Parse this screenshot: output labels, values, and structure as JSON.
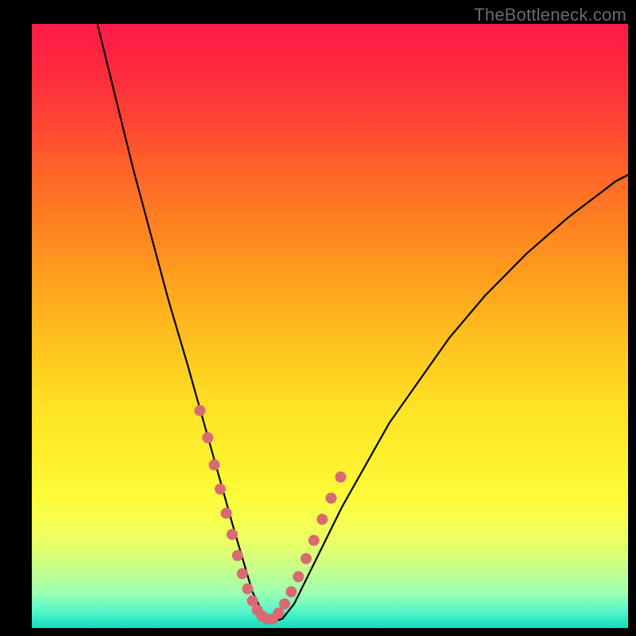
{
  "watermark": "TheBottleneck.com",
  "chart_data": {
    "type": "line",
    "title": "",
    "xlabel": "",
    "ylabel": "",
    "xlim": [
      0,
      100
    ],
    "ylim": [
      0,
      100
    ],
    "grid": false,
    "legend": false,
    "note": "Axes are unlabeled in the source image; values below are normalized percentages estimated from pixel positions within the gradient plot area (0 = left/bottom, 100 = right/top).",
    "series": [
      {
        "name": "bottleneck-curve",
        "color": "#000000",
        "x": [
          11.0,
          14.0,
          17.0,
          20.0,
          23.0,
          26.0,
          28.0,
          30.0,
          32.0,
          34.0,
          35.5,
          37.0,
          38.5,
          40.0,
          42.0,
          44.0,
          46.0,
          49.0,
          52.0,
          56.0,
          60.0,
          65.0,
          70.0,
          76.0,
          83.0,
          90.0,
          98.0,
          100.0
        ],
        "y": [
          100.0,
          88.0,
          76.0,
          65.0,
          54.0,
          44.0,
          37.0,
          30.0,
          23.0,
          16.0,
          11.0,
          6.0,
          3.0,
          1.0,
          1.5,
          4.0,
          8.0,
          14.0,
          20.0,
          27.0,
          34.0,
          41.0,
          48.0,
          55.0,
          62.0,
          68.0,
          74.0,
          75.0
        ]
      },
      {
        "name": "dot-markers",
        "color": "#d96a74",
        "type": "scatter",
        "x": [
          28.2,
          29.5,
          30.6,
          31.6,
          32.6,
          33.6,
          34.5,
          35.3,
          36.2,
          37.0,
          37.8,
          38.6,
          39.4,
          40.4,
          41.4,
          42.4,
          43.5,
          44.7,
          46.0,
          47.3,
          48.7,
          50.2,
          51.8
        ],
        "y": [
          36.0,
          31.5,
          27.0,
          23.0,
          19.0,
          15.5,
          12.0,
          9.0,
          6.5,
          4.5,
          3.0,
          2.0,
          1.5,
          1.5,
          2.5,
          4.0,
          6.0,
          8.5,
          11.5,
          14.5,
          18.0,
          21.5,
          25.0
        ]
      }
    ]
  }
}
